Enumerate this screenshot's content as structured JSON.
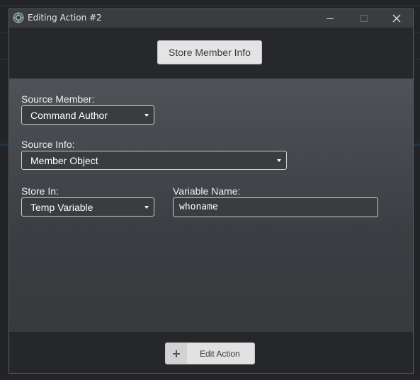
{
  "window": {
    "title": "Editing Action #2"
  },
  "header": {
    "action_button_label": "Store Member Info"
  },
  "form": {
    "source_member": {
      "label": "Source Member:",
      "value": "Command Author"
    },
    "source_info": {
      "label": "Source Info:",
      "value": "Member Object"
    },
    "store_in": {
      "label": "Store In:",
      "value": "Temp Variable"
    },
    "variable_name": {
      "label": "Variable Name:",
      "value": "whoname"
    }
  },
  "footer": {
    "edit_action_label": "Edit Action",
    "edit_action_icon": "plus-icon"
  },
  "colors": {
    "dialog_bg": "#2b2c30",
    "content_bg": "#45474c",
    "button_bg": "#e4e4e4",
    "field_border": "#cfcfcf"
  }
}
